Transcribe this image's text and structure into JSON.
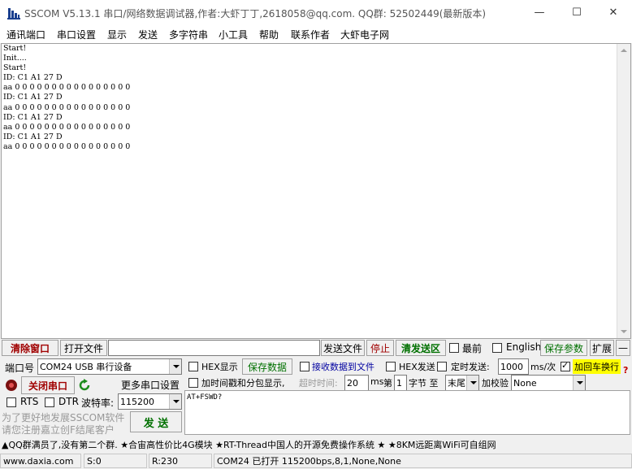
{
  "window": {
    "title": "SSCOM V5.13.1 串口/网络数据调试器,作者:大虾丁丁,2618058@qq.com. QQ群: 52502449(最新版本)",
    "min_glyph": "—",
    "max_glyph": "☐",
    "close_glyph": "✕"
  },
  "menu": [
    "通讯端口",
    "串口设置",
    "显示",
    "发送",
    "多字符串",
    "小工具",
    "帮助",
    "联系作者",
    "大虾电子网"
  ],
  "receive": {
    "lines": [
      "Start!",
      "Init....",
      "Start!",
      "ID: C1 A1 27 D",
      "aa 0 0 0 0 0 0 0 0 0 0 0 0 0 0 0 0",
      "ID: C1 A1 27 D",
      "aa 0 0 0 0 0 0 0 0 0 0 0 0 0 0 0 0",
      "ID: C1 A1 27 D",
      "aa 0 0 0 0 0 0 0 0 0 0 0 0 0 0 0 0",
      "ID: C1 A1 27 D",
      "aa 0 0 0 0 0 0 0 0 0 0 0 0 0 0 0 0"
    ]
  },
  "toolbar": {
    "clear_window": "清除窗口",
    "open_file": "打开文件",
    "file_path": "",
    "send_file": "发送文件",
    "stop": "停止",
    "clear_send": "清发送区",
    "topmost": "最前",
    "english": "English",
    "save_params": "保存参数",
    "expand": "扩展",
    "collapse": "—"
  },
  "port": {
    "label": "端口号",
    "value": "COM24 USB 串行设备",
    "close_port": "关闭串口",
    "more_settings": "更多串口设置",
    "rts": "RTS",
    "dtr": "DTR",
    "baud_label": "波特率:",
    "baud_value": "115200"
  },
  "options": {
    "hex_display": "HEX显示",
    "save_data": "保存数据",
    "recv_to_file": "接收数据到文件",
    "hex_send": "HEX发送",
    "timed_send": "定时发送:",
    "interval_value": "1000",
    "interval_unit": "ms/次",
    "add_crlf": "加回车换行",
    "timestamp": "加时间戳和分包显示,",
    "timeout_label": "超时时间:",
    "timeout_value": "20",
    "timeout_unit": "ms",
    "byte_label_pre": "第",
    "byte_value": "1",
    "byte_label_post": "字节 至",
    "end_value": "末尾",
    "checksum_label": "加校验",
    "checksum_value": "None",
    "help_glyph": "?"
  },
  "send": {
    "text": "AT+FSWD?",
    "button": "发 送"
  },
  "promo": {
    "line1": "为了更好地发展SSCOM软件",
    "line2": "请您注册嘉立创F结尾客户"
  },
  "ad": "▲QQ群满员了,没有第二个群. ★合宙高性价比4G模块 ★RT-Thread中国人的开源免费操作系统 ★ ★8KM远距离WiFi可自组网",
  "status": {
    "site": "www.daxia.com",
    "sent": "S:0",
    "received": "R:230",
    "port_info": "COM24 已打开  115200bps,8,1,None,None"
  },
  "colors": {
    "clear_text": "#a00000",
    "green_text": "#007000",
    "highlight": "#ffff00"
  }
}
